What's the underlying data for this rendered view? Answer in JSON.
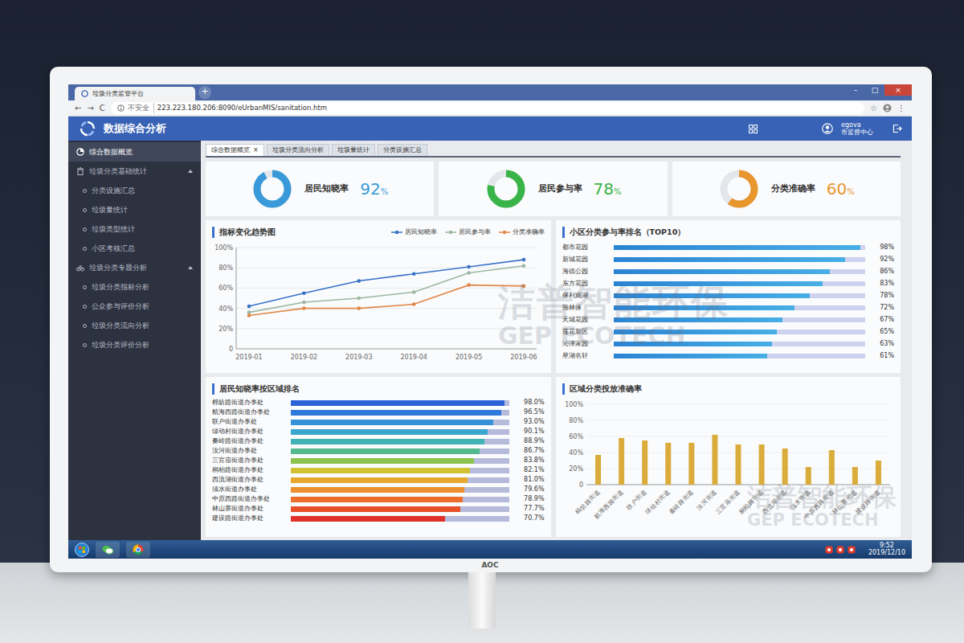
{
  "monitor": {
    "brand": "AOC"
  },
  "browser": {
    "tab_title": "垃圾分类监管平台",
    "new_tab": "+",
    "window_controls": [
      "–",
      "□",
      "×"
    ],
    "nav_buttons": [
      "←",
      "→",
      "C"
    ],
    "insecure": "不安全",
    "url": "223.223.180.206:8090/eUrbanMIS/sanitation.htm",
    "bookmark": "☆",
    "menu": "⋮"
  },
  "app": {
    "title": "数据综合分析",
    "user": "egova",
    "org": "市监督中心"
  },
  "sidebar": {
    "items": [
      {
        "label": "综合数据概览",
        "selected": true
      }
    ],
    "groups": [
      {
        "label": "垃圾分类基础统计",
        "expanded": true,
        "items": [
          {
            "label": "分类设施汇总",
            "selected": false
          },
          {
            "label": "垃圾量统计",
            "selected": false
          },
          {
            "label": "垃圾类型统计",
            "selected": false
          },
          {
            "label": "小区考核汇总",
            "selected": false
          }
        ]
      },
      {
        "label": "垃圾分类专题分析",
        "expanded": true,
        "items": [
          {
            "label": "垃圾分类指标分析",
            "selected": false
          },
          {
            "label": "公众参与评价分析",
            "selected": false
          },
          {
            "label": "垃圾分类流向分析",
            "selected": false
          },
          {
            "label": "垃圾分类评价分析",
            "selected": false
          }
        ]
      }
    ]
  },
  "tabs": [
    {
      "label": "综合数据概览",
      "selected": true,
      "close": "×"
    },
    {
      "label": "垃圾分类流向分析",
      "selected": false
    },
    {
      "label": "垃圾量统计",
      "selected": false
    },
    {
      "label": "分类设施汇总",
      "selected": false
    }
  ],
  "kpis": [
    {
      "label": "居民知晓率",
      "value": "92",
      "unit": "%",
      "level": 0.92,
      "color": "#3a9ad9"
    },
    {
      "label": "居民参与率",
      "value": "78",
      "unit": "%",
      "level": 0.78,
      "color": "#38b449"
    },
    {
      "label": "分类准确率",
      "value": "60",
      "unit": "%",
      "level": 0.6,
      "color": "#e8962e"
    }
  ],
  "trend": {
    "title": "指标变化趋势图",
    "y_ticks": [
      "100%",
      "80%",
      "60%",
      "40%",
      "20%",
      "0"
    ],
    "x_labels": [
      "2019-01",
      "2019-02",
      "2019-03",
      "2019-04",
      "2019-05",
      "2019-06"
    ],
    "series": [
      {
        "name": "居民知晓率",
        "color": "#3a72c9",
        "values": [
          42,
          55,
          67,
          74,
          81,
          88
        ]
      },
      {
        "name": "居民参与率",
        "color": "#9bb7a0",
        "values": [
          36,
          46,
          50,
          56,
          75,
          82
        ]
      },
      {
        "name": "分类准确率",
        "color": "#e0874a",
        "values": [
          33,
          40,
          40,
          44,
          63,
          62
        ]
      }
    ]
  },
  "community_rank": {
    "title": "小区分类参与率排名（TOP10）",
    "rows": [
      {
        "name": "都市花园",
        "value": "98%",
        "level": 0.98
      },
      {
        "name": "新城花园",
        "value": "92%",
        "level": 0.92
      },
      {
        "name": "海德公园",
        "value": "86%",
        "level": 0.86
      },
      {
        "name": "东方花园",
        "value": "83%",
        "level": 0.83
      },
      {
        "name": "保利观湖",
        "value": "78%",
        "level": 0.78
      },
      {
        "name": "翰林缘",
        "value": "72%",
        "level": 0.72
      },
      {
        "name": "天城花园",
        "value": "67%",
        "level": 0.67
      },
      {
        "name": "莲花新区",
        "value": "65%",
        "level": 0.65
      },
      {
        "name": "沁泽家园",
        "value": "63%",
        "level": 0.63
      },
      {
        "name": "星湖名轩",
        "value": "61%",
        "level": 0.61
      }
    ]
  },
  "district_awareness": {
    "title": "居民知晓率按区域排名",
    "rows": [
      {
        "name": "棉纺路街道办事处",
        "value": "98.0%",
        "level": 0.98,
        "color": "#2a63d8"
      },
      {
        "name": "航海西路街道办事处",
        "value": "96.5%",
        "level": 0.965,
        "color": "#2f78dc"
      },
      {
        "name": "联户街道办事处",
        "value": "93.0%",
        "level": 0.93,
        "color": "#3592d8"
      },
      {
        "name": "绿动村街道办事处",
        "value": "90.1%",
        "level": 0.901,
        "color": "#3aa7cf"
      },
      {
        "name": "秦岭路街道办事处",
        "value": "88.9%",
        "level": 0.889,
        "color": "#3fb3b5"
      },
      {
        "name": "汝河街道办事处",
        "value": "86.7%",
        "level": 0.867,
        "color": "#54b98f"
      },
      {
        "name": "三官庙街道办事处",
        "value": "83.8%",
        "level": 0.838,
        "color": "#8cc24d"
      },
      {
        "name": "桐柏路街道办事处",
        "value": "82.1%",
        "level": 0.821,
        "color": "#d2c233"
      },
      {
        "name": "西流湖街道办事处",
        "value": "81.0%",
        "level": 0.81,
        "color": "#e8a830"
      },
      {
        "name": "须水街道办事处",
        "value": "79.6%",
        "level": 0.796,
        "color": "#ec8f2d"
      },
      {
        "name": "中原西路街道办事处",
        "value": "78.9%",
        "level": 0.789,
        "color": "#ec6e2a"
      },
      {
        "name": "林山寨街道办事处",
        "value": "77.7%",
        "level": 0.777,
        "color": "#e8502a"
      },
      {
        "name": "建设路街道办事处",
        "value": "70.7%",
        "level": 0.707,
        "color": "#e0302a"
      }
    ]
  },
  "district_accuracy": {
    "title": "区域分类投放准确率",
    "y_ticks": [
      "100%",
      "80%",
      "60%",
      "40%",
      "20%",
      "0"
    ],
    "labels": [
      "棉纺路街道",
      "航海西路街道",
      "联户街道",
      "绿动村街道",
      "秦岭路街道",
      "汝河街道",
      "三官庙街道",
      "桐柏路街道",
      "西流湖街道",
      "须水街道",
      "中原西路街道",
      "林山寨街道",
      "建设路街道"
    ],
    "values": [
      37,
      58,
      55,
      52,
      52,
      62,
      50,
      50,
      45,
      22,
      43,
      22,
      30
    ]
  },
  "taskbar": {
    "time": "9:52",
    "date": "2019/12/10"
  },
  "watermarks": [
    {
      "cn": "洁普智能环保",
      "en": "GEP ECOTECH"
    },
    {
      "cn": "洁普智能环保",
      "en": "GEP ECOTECH"
    }
  ]
}
